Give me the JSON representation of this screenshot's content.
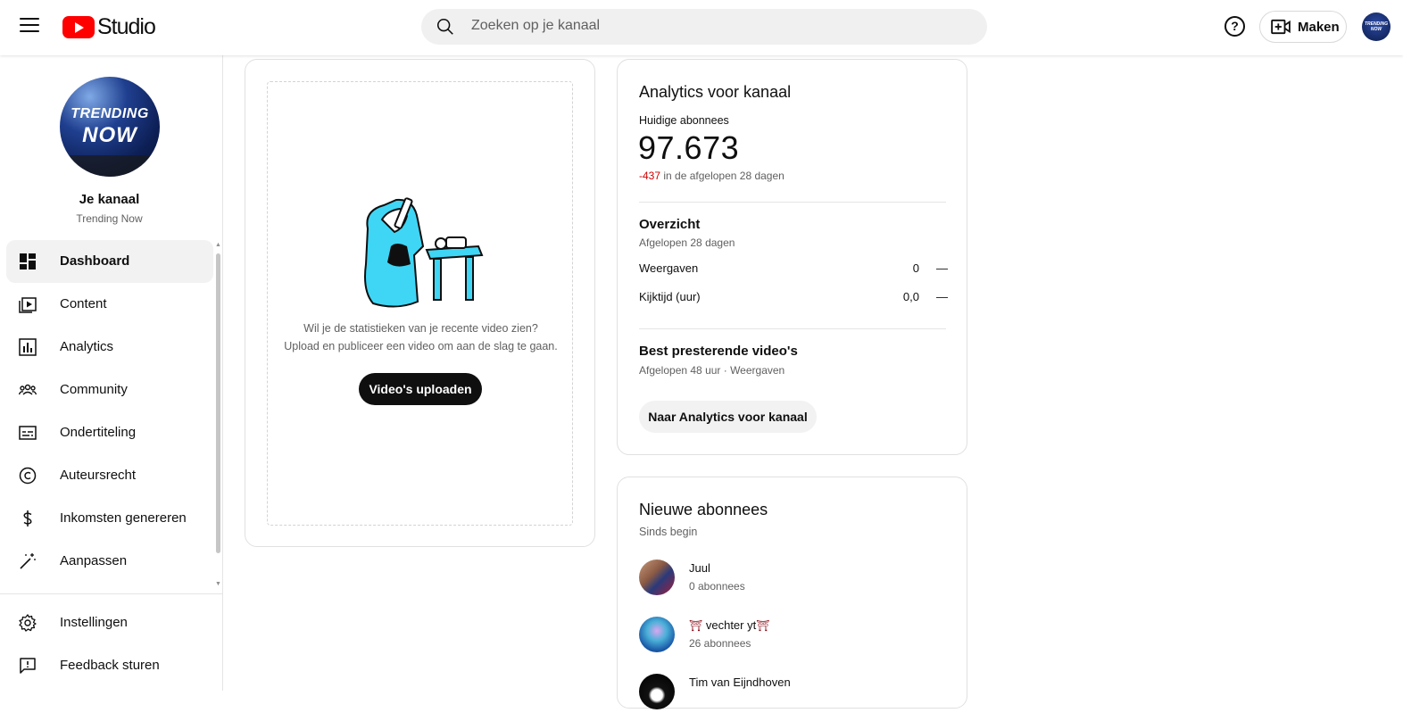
{
  "topbar": {
    "logo_text": "Studio",
    "search_placeholder": "Zoeken op je kanaal",
    "help_symbol": "?",
    "create_label": "Maken",
    "account_avatar_text": "TRENDING NOW"
  },
  "sidebar": {
    "channel_avatar_line1": "TRENDING",
    "channel_avatar_line2": "NOW",
    "channel_title": "Je kanaal",
    "channel_name": "Trending Now",
    "items": [
      {
        "label": "Dashboard",
        "icon": "dashboard-icon",
        "active": true
      },
      {
        "label": "Content",
        "icon": "content-icon"
      },
      {
        "label": "Analytics",
        "icon": "analytics-icon"
      },
      {
        "label": "Community",
        "icon": "community-icon"
      },
      {
        "label": "Ondertiteling",
        "icon": "subtitles-icon"
      },
      {
        "label": "Auteursrecht",
        "icon": "copyright-icon"
      },
      {
        "label": "Inkomsten genereren",
        "icon": "dollar-icon"
      },
      {
        "label": "Aanpassen",
        "icon": "magic-wand-icon"
      }
    ],
    "bottom_items": [
      {
        "label": "Instellingen",
        "icon": "gear-icon"
      },
      {
        "label": "Feedback sturen",
        "icon": "feedback-icon"
      }
    ]
  },
  "upload_card": {
    "line1": "Wil je de statistieken van je recente video zien?",
    "line2": "Upload en publiceer een video om aan de slag te gaan.",
    "button": "Video's uploaden"
  },
  "analytics": {
    "title": "Analytics voor kanaal",
    "subscribers_label": "Huidige abonnees",
    "subscribers_value": "97.673",
    "delta_value": "-437",
    "delta_text": " in de afgelopen 28 dagen",
    "overview_title": "Overzicht",
    "overview_period": "Afgelopen 28 dagen",
    "views_label": "Weergaven",
    "views_value": "0",
    "views_trend": "—",
    "watchtime_label": "Kijktijd (uur)",
    "watchtime_value": "0,0",
    "watchtime_trend": "—",
    "top_videos_title": "Best presterende video's",
    "top_videos_period": "Afgelopen 48 uur · Weergaven",
    "button": "Naar Analytics voor kanaal"
  },
  "new_subscribers": {
    "title": "Nieuwe abonnees",
    "period": "Sinds begin",
    "list": [
      {
        "name": "Juul",
        "count": "0 abonnees"
      },
      {
        "name": "vechter yt",
        "count": "26 abonnees"
      },
      {
        "name": "Tim van Eijndhoven",
        "count": ""
      }
    ]
  },
  "colors": {
    "brand_red": "#ff0000",
    "negative": "#cc0000",
    "text_secondary": "#606060",
    "button_dark": "#0f0f0f"
  }
}
